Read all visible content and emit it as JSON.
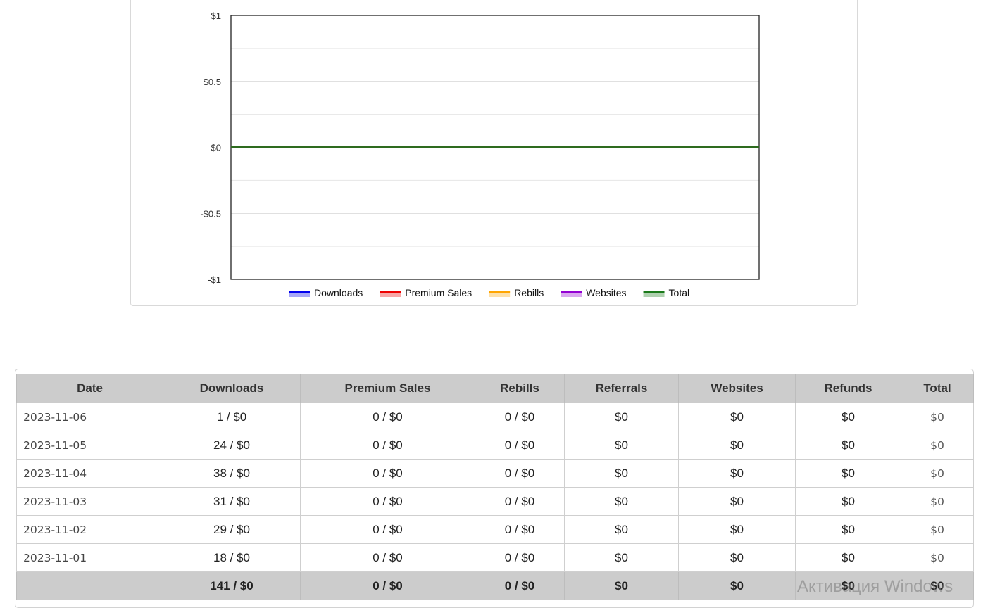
{
  "chart_data": {
    "type": "line",
    "yticks": [
      "$1",
      "$0.5",
      "$0",
      "-$0.5",
      "-$1"
    ],
    "ylim": [
      -1,
      1
    ],
    "grid": true,
    "legend_position": "bottom",
    "series": [
      {
        "name": "Downloads",
        "color": "#0000ee",
        "values": [
          0,
          0,
          0,
          0,
          0,
          0
        ]
      },
      {
        "name": "Premium Sales",
        "color": "#ee0000",
        "values": [
          0,
          0,
          0,
          0,
          0,
          0
        ]
      },
      {
        "name": "Rebills",
        "color": "#ffa500",
        "values": [
          0,
          0,
          0,
          0,
          0,
          0
        ]
      },
      {
        "name": "Websites",
        "color": "#9400d3",
        "values": [
          0,
          0,
          0,
          0,
          0,
          0
        ]
      },
      {
        "name": "Total",
        "color": "#1a7a1a",
        "values": [
          0,
          0,
          0,
          0,
          0,
          0
        ]
      }
    ]
  },
  "table": {
    "headers": [
      "Date",
      "Downloads",
      "Premium Sales",
      "Rebills",
      "Referrals",
      "Websites",
      "Refunds",
      "Total"
    ],
    "rows": [
      [
        "2023-11-06",
        "1 / $0",
        "0 / $0",
        "0 / $0",
        "$0",
        "$0",
        "$0",
        "$0"
      ],
      [
        "2023-11-05",
        "24 / $0",
        "0 / $0",
        "0 / $0",
        "$0",
        "$0",
        "$0",
        "$0"
      ],
      [
        "2023-11-04",
        "38 / $0",
        "0 / $0",
        "0 / $0",
        "$0",
        "$0",
        "$0",
        "$0"
      ],
      [
        "2023-11-03",
        "31 / $0",
        "0 / $0",
        "0 / $0",
        "$0",
        "$0",
        "$0",
        "$0"
      ],
      [
        "2023-11-02",
        "29 / $0",
        "0 / $0",
        "0 / $0",
        "$0",
        "$0",
        "$0",
        "$0"
      ],
      [
        "2023-11-01",
        "18 / $0",
        "0 / $0",
        "0 / $0",
        "$0",
        "$0",
        "$0",
        "$0"
      ]
    ],
    "totals": [
      "",
      "141 / $0",
      "0 / $0",
      "0 / $0",
      "$0",
      "$0",
      "$0",
      "$0"
    ]
  },
  "watermark": "Активация Windows"
}
